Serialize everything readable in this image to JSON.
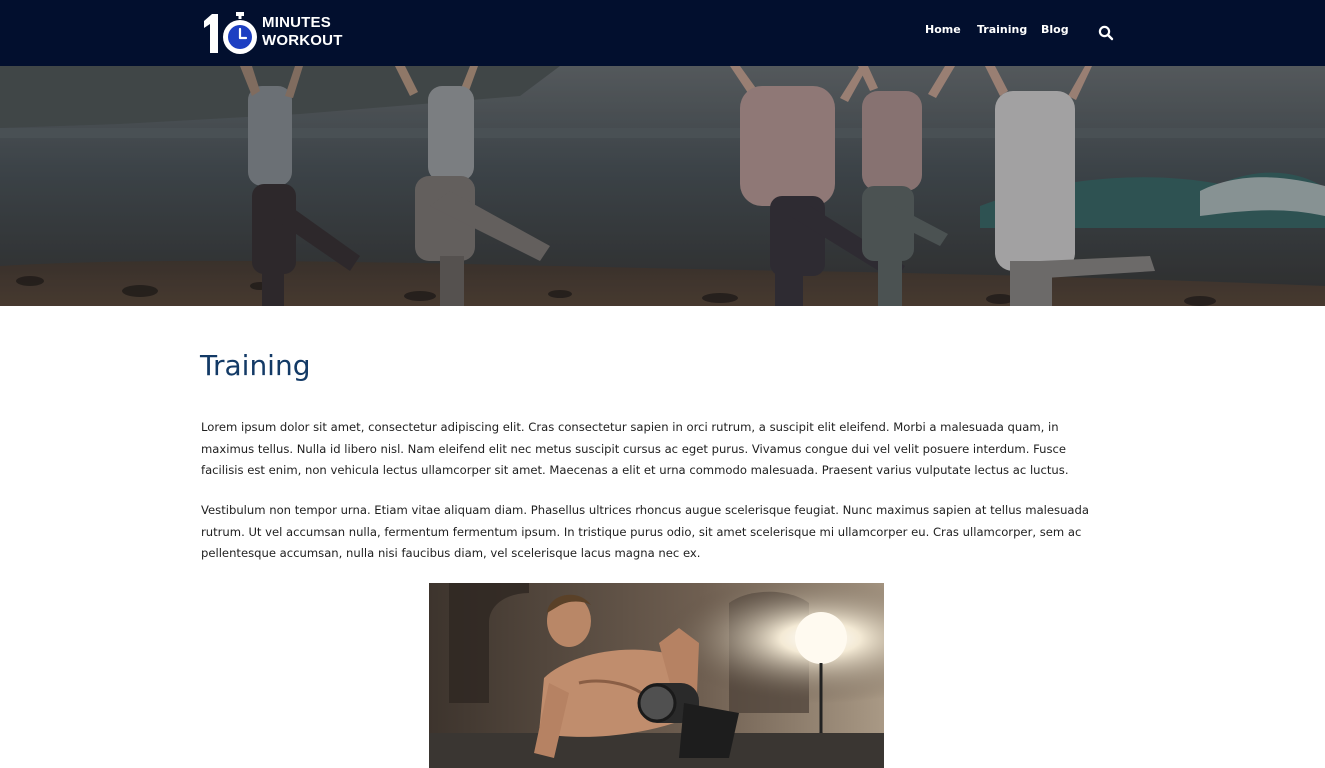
{
  "brand": {
    "logo_number": "10",
    "logo_line1": "MINUTES",
    "logo_line2": "WORKOUT"
  },
  "nav": {
    "items": [
      "Home",
      "Training",
      "Blog"
    ],
    "search_icon": "search-icon"
  },
  "page": {
    "title": "Training",
    "paragraphs": [
      "Lorem ipsum dolor sit amet, consectetur adipiscing elit. Cras consectetur sapien in orci rutrum, a suscipit elit eleifend. Morbi a malesuada quam, in maximus tellus. Nulla id libero nisl. Nam eleifend elit nec metus suscipit cursus ac eget purus. Vivamus congue dui vel velit posuere interdum. Fusce facilisis est enim, non vehicula lectus ullamcorper sit amet. Maecenas a elit et urna commodo malesuada. Praesent varius vulputate lectus ac luctus.",
      "Vestibulum non tempor urna. Etiam vitae aliquam diam. Phasellus ultrices rhoncus augue scelerisque feugiat. Nunc maximus sapien at tellus malesuada rutrum. Ut vel accumsan nulla, fermentum fermentum ipsum. In tristique purus odio, sit amet scelerisque mi ullamcorper eu. Cras ullamcorper, sem ac pellentesque accumsan, nulla nisi faucibus diam, vel scelerisque lacus magna nec ex."
    ]
  },
  "colors": {
    "header_bg": "#020f2e",
    "title": "#133a66",
    "logo_accent": "#1d3fc2"
  }
}
